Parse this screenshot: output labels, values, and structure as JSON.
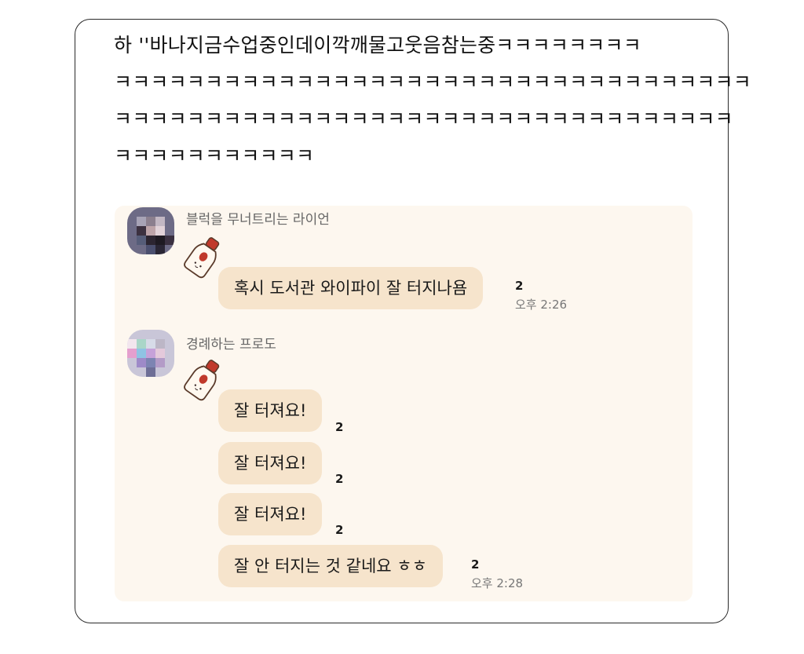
{
  "post": {
    "lines": [
      "하 ''바나지금수업중인데이깍깨물고웃음참는중ㅋㅋㅋㅋㅋㅋㅋㅋ",
      "ㅋㅋㅋㅋㅋㅋㅋㅋㅋㅋㅋㅋㅋㅋㅋㅋㅋㅋㅋㅋㅋㅋㅋㅋㅋㅋㅋㅋㅋㅋㅋㅋㅋㅋㅋ",
      "ㅋㅋㅋㅋㅋㅋㅋㅋㅋㅋㅋㅋㅋㅋㅋㅋㅋㅋㅋㅋㅋㅋㅋㅋㅋㅋㅋㅋㅋㅋㅋㅋㅋㅋ",
      "ㅋㅋㅋㅋㅋㅋㅋㅋㅋㅋㅋ"
    ]
  },
  "chat": {
    "messages": [
      {
        "sender": "블럭을 무너트리는 라이언",
        "bubbles": [
          {
            "text": "혹시 도서관 와이파이 잘 터지나욤",
            "count": "2",
            "time": "오후 2:26"
          }
        ]
      },
      {
        "sender": "경례하는 프로도",
        "bubbles": [
          {
            "text": "잘 터져요!",
            "count": "2",
            "time": ""
          },
          {
            "text": "잘 터져요!",
            "count": "2",
            "time": ""
          },
          {
            "text": "잘 터져요!",
            "count": "2",
            "time": ""
          },
          {
            "text": "잘 안 터지는 것 같네요 ㅎㅎ",
            "count": "2",
            "time": "오후 2:28"
          }
        ]
      }
    ]
  },
  "colors": {
    "chat_background": "#fdf7ef",
    "bubble": "#f6e4cc",
    "sticker_cap": "#c0392b"
  },
  "icons": [
    "avatar-pixelated",
    "bottle-sticker-icon"
  ]
}
